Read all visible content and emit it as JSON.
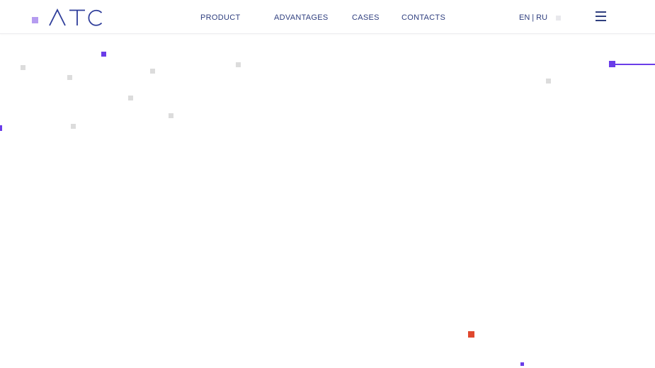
{
  "brand": {
    "logo_text": "ATC",
    "logo_color": "#2e3d9a",
    "square_color": "#b59cf0"
  },
  "nav": {
    "items": [
      {
        "label": "PRODUCT"
      },
      {
        "label": "ADVANTAGES"
      },
      {
        "label": "CASES"
      },
      {
        "label": "CONTACTS"
      }
    ],
    "text_color": "#2f3f7f"
  },
  "language": {
    "options": [
      "EN",
      "RU"
    ],
    "separator": "|"
  },
  "menu": {
    "icon": "hamburger-menu-icon"
  },
  "colors": {
    "accent_purple": "#6a3de8",
    "accent_red": "#e0482e",
    "light_gray": "#dcdcdc",
    "muted_dot": "#e8e8ec"
  }
}
